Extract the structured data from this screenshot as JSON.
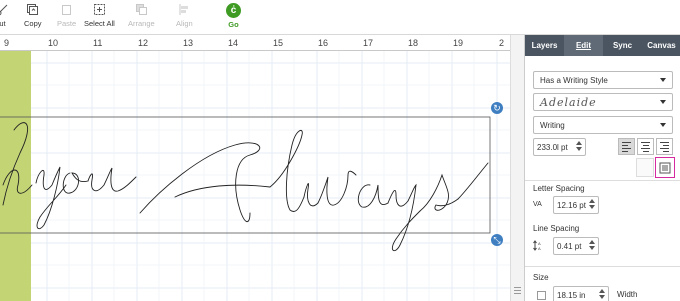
{
  "toolbar": {
    "items": [
      {
        "label": "ut",
        "icon": "cut-icon",
        "disabled": false
      },
      {
        "label": "Copy",
        "icon": "copy-icon",
        "disabled": false
      },
      {
        "label": "Paste",
        "icon": "paste-icon",
        "disabled": true
      },
      {
        "label": "Select All",
        "icon": "select-all-icon",
        "disabled": false
      },
      {
        "label": "Arrange",
        "icon": "arrange-icon",
        "disabled": true
      },
      {
        "label": "Align",
        "icon": "align-icon",
        "disabled": true
      }
    ],
    "go_label": "Go",
    "go_icon": "ċ",
    "go_color": "#3f9b24"
  },
  "ruler": {
    "numbers": [
      "9",
      "10",
      "11",
      "12",
      "13",
      "14",
      "15",
      "16",
      "17",
      "18",
      "19",
      "2"
    ]
  },
  "canvas": {
    "text_content": "hyouAlways",
    "mat_color": "#c3d475",
    "selection_handle_color": "#3f7fc1"
  },
  "panel": {
    "tabs": [
      "Layers",
      "Edit",
      "Sync",
      "Canvas"
    ],
    "active_tab": "Edit",
    "text_style": "Has a Writing Style",
    "font_name": "Adelaide",
    "font_style": "Writing",
    "font_size": "233.0l pt",
    "letter_spacing_label": "Letter Spacing",
    "letter_spacing_icon": "VA",
    "letter_spacing_value": "12.16 pt",
    "line_spacing_label": "Line Spacing",
    "line_spacing_value": "0.41  pt",
    "size_label": "Size",
    "size_value": "18.15 in",
    "width_label": "Width",
    "advanced_button_border": "#d62aa0"
  }
}
